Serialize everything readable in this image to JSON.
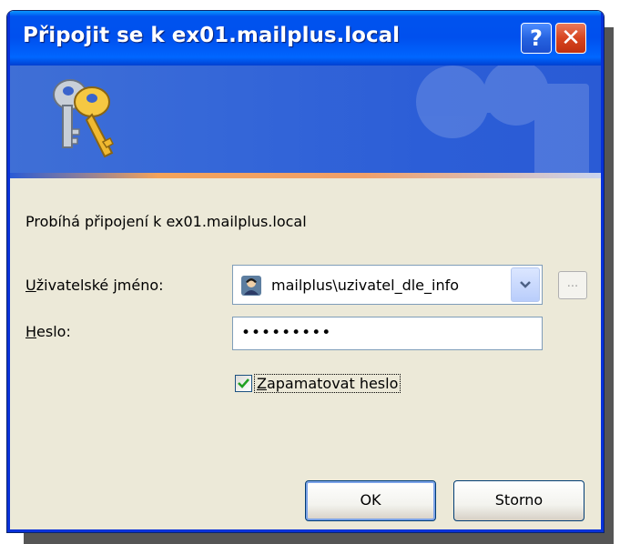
{
  "window": {
    "title": "Připojit se k ex01.mailplus.local",
    "help_glyph": "?",
    "close_glyph": "✕"
  },
  "banner": {
    "icon": "keys-icon"
  },
  "status": {
    "text": "Probíhá připojení k ex01.mailplus.local"
  },
  "form": {
    "username_label_first": "U",
    "username_label_rest": "živatelské jméno:",
    "username_value": "mailplus\\uzivatel_dle_info",
    "browse_label": "...",
    "password_label_first": "H",
    "password_label_rest": "eslo:",
    "password_value": "•••••••••",
    "remember_label_first": "Z",
    "remember_label_rest": "apamatovat heslo",
    "remember_checked": true
  },
  "buttons": {
    "ok": "OK",
    "cancel": "Storno"
  },
  "colors": {
    "titlebar": "#0050ee",
    "dialog_bg": "#ece9d8",
    "close_red": "#d8451f"
  }
}
